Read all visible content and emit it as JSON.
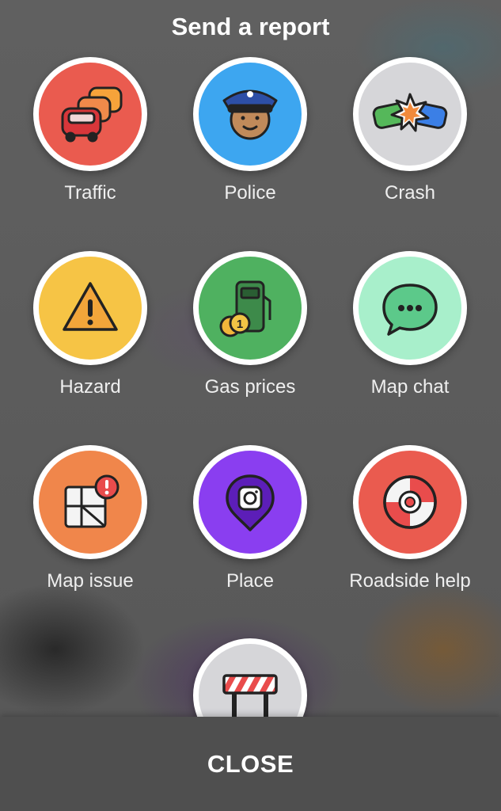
{
  "header": {
    "title": "Send a report"
  },
  "items": [
    {
      "label": "Traffic",
      "icon": "traffic-cars-icon",
      "color": "#ea5b4f"
    },
    {
      "label": "Police",
      "icon": "police-officer-icon",
      "color": "#3da6f0"
    },
    {
      "label": "Crash",
      "icon": "crash-icon",
      "color": "#d6d6d9"
    },
    {
      "label": "Hazard",
      "icon": "hazard-warning-icon",
      "color": "#f6c445"
    },
    {
      "label": "Gas prices",
      "icon": "gas-pump-icon",
      "color": "#4fb160"
    },
    {
      "label": "Map chat",
      "icon": "chat-bubble-icon",
      "color": "#a8efcb"
    },
    {
      "label": "Map issue",
      "icon": "map-issue-icon",
      "color": "#f0864b"
    },
    {
      "label": "Place",
      "icon": "place-camera-icon",
      "color": "#8a3ef0"
    },
    {
      "label": "Roadside help",
      "icon": "lifebuoy-icon",
      "color": "#ea5b4f"
    },
    {
      "label": "",
      "icon": "road-closure-barrier-icon",
      "color": "#d6d6d9"
    }
  ],
  "footer": {
    "close_label": "CLOSE"
  }
}
